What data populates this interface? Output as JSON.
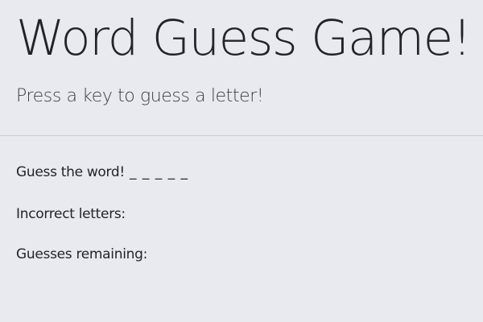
{
  "header": {
    "title": "Word Guess Game!",
    "subtitle": "Press a key to guess a letter!"
  },
  "game": {
    "word_label": "Guess the word!",
    "word_display": "_ _ _ _ _",
    "incorrect_label": "Incorrect letters:",
    "incorrect_value": "",
    "remaining_label": "Guesses remaining:",
    "remaining_value": ""
  },
  "colors": {
    "background": "#e9eaef",
    "text": "#212529",
    "divider": "#c9cbd0"
  }
}
